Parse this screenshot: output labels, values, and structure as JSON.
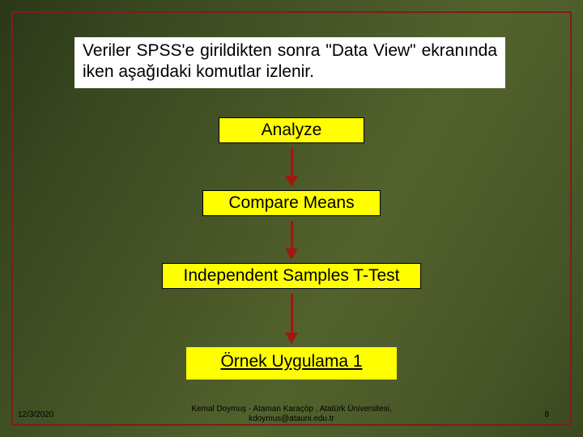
{
  "intro_text": "Veriler SPSS'e girildikten sonra \"Data View\" ekranında iken aşağıdaki komutlar izlenir.",
  "steps": {
    "analyze": "Analyze",
    "compare": "Compare Means",
    "ttest": "Independent Samples T-Test",
    "example_link": "Örnek Uygulama 1"
  },
  "footer": {
    "date": "12/3/2020",
    "center": "Kemal Doymuş - Ataman Karaçöp , Atatürk Üniversitesi, kdoymus@atauni.edu.tr",
    "page": "8"
  }
}
